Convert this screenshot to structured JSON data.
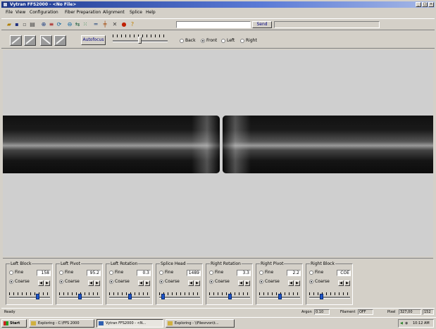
{
  "window": {
    "title": "Vytran FFS2000 - <No File>",
    "min": "_",
    "max": "□",
    "close": "×"
  },
  "menu": [
    "File",
    "View",
    "Configuration",
    "Fiber Preparation",
    "Alignment",
    "Splice",
    "Help"
  ],
  "toolbar": {
    "command_value": "",
    "send_label": "Send",
    "response_value": ""
  },
  "view_bar": {
    "autofocus_label": "Autofocus",
    "view_options": [
      "Back",
      "Front",
      "Left",
      "Right"
    ],
    "selected_view": "Front"
  },
  "controls": [
    {
      "title": "Left Block",
      "value": "158",
      "selected": "Coarse",
      "level": 0.72
    },
    {
      "title": "Left Pivot",
      "value": "95.2",
      "selected": "Coarse",
      "level": 0.5
    },
    {
      "title": "Left Rotation",
      "value": "0.3",
      "selected": "Coarse",
      "level": 0.5
    },
    {
      "title": "Splice Head",
      "value": "1489",
      "selected": "Coarse",
      "level": 0.05
    },
    {
      "title": "Right Rotation",
      "value": "3.3",
      "selected": "Coarse",
      "level": 0.5
    },
    {
      "title": "Right Pivot",
      "value": "2.2",
      "selected": "Coarse",
      "level": 0.5
    },
    {
      "title": "Right Block",
      "value": "COE",
      "selected": "Coarse",
      "level": 0.28
    }
  ],
  "radio_labels": {
    "fine": "Fine",
    "coarse": "Coarse"
  },
  "status": {
    "left": "Ready",
    "argon_label": "Argon",
    "argon_value": "0.10",
    "filament_label": "Filament",
    "filament_value": "OFF",
    "pixel_label": "Pixel",
    "pixel_value": "327,00",
    "extra": "152"
  },
  "taskbar": {
    "start": "Start",
    "tasks": [
      "Exploring - C:\\FFS 2000",
      "Vytran FFS2000 - <N...",
      "Exploring - \\\\Filesrvon\\t..."
    ],
    "clock": "10:12 AM"
  }
}
